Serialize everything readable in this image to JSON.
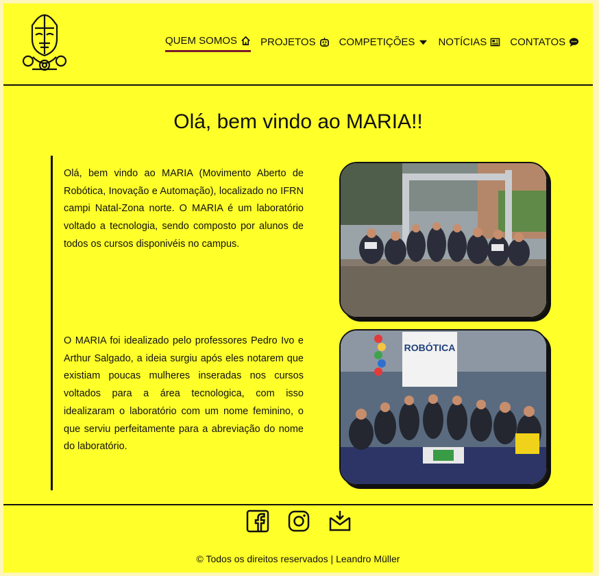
{
  "nav": {
    "items": [
      {
        "label": "QUEM SOMOS",
        "icon": "home-icon",
        "active": true
      },
      {
        "label": "PROJETOS",
        "icon": "robot-icon",
        "active": false
      },
      {
        "label": "COMPETIÇÕES",
        "icon": "caret-down-icon",
        "active": false
      },
      {
        "label": "NOTÍCIAS",
        "icon": "newspaper-icon",
        "active": false
      },
      {
        "label": "CONTATOS",
        "icon": "chat-icon",
        "active": false
      }
    ]
  },
  "main": {
    "title": "Olá, bem vindo ao MARIA!!",
    "paragraph1": "Olá, bem vindo ao MARIA (Movimento Aberto de Robótica, Inovação e Automação), localizado no IFRN campi Natal-Zona norte. O MARIA é um laboratório voltado a tecnologia, sendo composto por alunos de todos os cursos disponivéis no campus.",
    "paragraph2": "O MARIA foi idealizado pelo professores Pedro Ivo e Arthur Salgado, a ideia surgiu após eles notarem que existiam poucas mulheres inseradas nos cursos voltados para a área tecnologica, com isso idealizaram o laboratório com um nome feminino, o que serviu perfeitamente para a abreviação do nome do laboratório.",
    "photo2_banner": "ROBÓTICA"
  },
  "footer": {
    "socials": [
      "facebook-icon",
      "instagram-icon",
      "mail-icon"
    ],
    "copyright": "© Todos os direitos reservados | Leandro Müller"
  },
  "colors": {
    "background": "#ffff2a",
    "outer": "#fdf6b8",
    "accent": "#7a1a2c",
    "ink": "#111111"
  }
}
